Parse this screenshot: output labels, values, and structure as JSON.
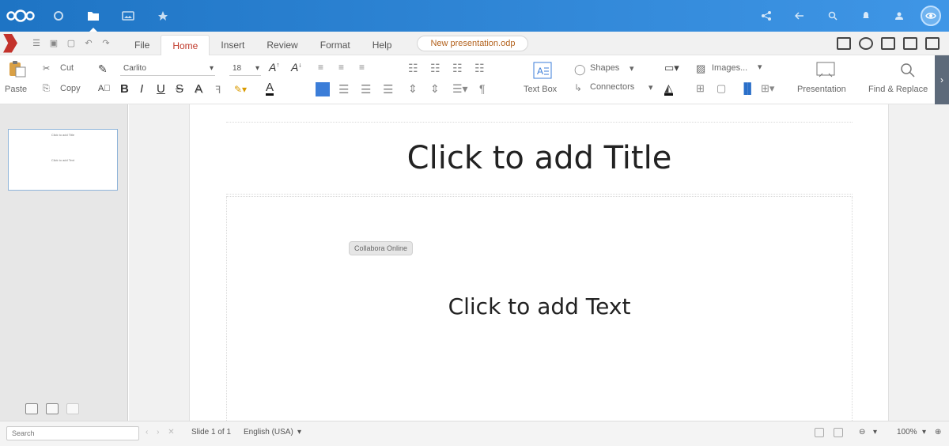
{
  "header": {
    "apps": [
      {
        "icon": "dashboard-icon"
      },
      {
        "icon": "files-icon",
        "active": true
      },
      {
        "icon": "photos-icon"
      },
      {
        "icon": "activity-icon"
      }
    ],
    "right_icons": [
      "share-icon",
      "back-icon",
      "search-icon",
      "notifications-icon",
      "contacts-icon"
    ]
  },
  "menubar": {
    "tabs": [
      "File",
      "Home",
      "Insert",
      "Review",
      "Format",
      "Help"
    ],
    "active_tab": "Home",
    "document_name": "New presentation.odp"
  },
  "ribbon": {
    "paste": "Paste",
    "cut": "Cut",
    "copy": "Copy",
    "font_name": "Carlito",
    "font_size": "18",
    "text_box": "Text Box",
    "shapes": "Shapes",
    "connectors": "Connectors",
    "images": "Images...",
    "presentation": "Presentation",
    "find_replace": "Find & Replace",
    "bold": "B",
    "italic": "I",
    "underline": "U",
    "strike": "S",
    "shadow": "A"
  },
  "slide_panel": {
    "thumb_title": "Click to add Title",
    "thumb_text": "Click to add Text"
  },
  "slide": {
    "title": "Click to add Title",
    "text": "Click to add Text",
    "layout_badge": "Collabora Online"
  },
  "statusbar": {
    "search_placeholder": "Search",
    "slide_info": "Slide 1 of 1",
    "language": "English (USA)",
    "zoom": "100%"
  },
  "colors": {
    "header_start": "#1e74c4",
    "header_end": "#3f96e6",
    "accent": "#c0392b"
  }
}
